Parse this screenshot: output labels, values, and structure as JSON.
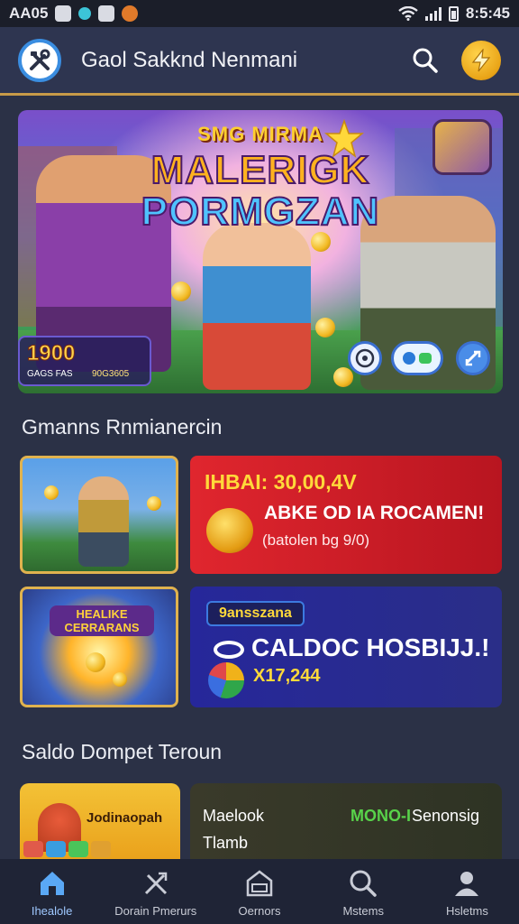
{
  "status_bar": {
    "left_text": "AA05",
    "time": "8:5:45"
  },
  "header": {
    "title": "Gaol Sakknd Nenmani"
  },
  "hero": {
    "subtitle": "SMG MIRMA",
    "title_line1": "MALERIGK",
    "title_line2": "PORMGZAN",
    "stat_value": "1900",
    "stat_label": "GAGS FAS",
    "stat_sub": "90G3605"
  },
  "sections": {
    "promo_title": "Gmanns Rnmianercin",
    "wallet_title": "Saldo Dompet Teroun"
  },
  "promos": {
    "thumb2_text": "HEALIKE CERRARANS",
    "red": {
      "title": "IHBAI: 30,00,4V",
      "main": "ABKE OD IA ROCAMEN!",
      "sub": "(batolen bg 9/0)"
    },
    "blue": {
      "badge": "9ansszana",
      "main": "CALDOC HOSBIJJ.!",
      "amount": "X17,244"
    }
  },
  "wallet": {
    "left_label": "Jodinaopah",
    "row1": "Maelook",
    "row2": "Tlamb",
    "status": "MONO-I",
    "status_text": "Senonsig"
  },
  "bottom_nav": {
    "items": [
      {
        "label": "Ihealole",
        "icon": "home-icon"
      },
      {
        "label": "Dorain Pmerurs",
        "icon": "tools-icon"
      },
      {
        "label": "Oernors",
        "icon": "store-icon"
      },
      {
        "label": "Mstems",
        "icon": "search-icon"
      },
      {
        "label": "Hsletms",
        "icon": "profile-icon"
      }
    ]
  },
  "colors": {
    "background": "#2b3146",
    "accent_gold": "#c79a48",
    "promo_red": "#e0262e",
    "promo_blue": "#26279a",
    "nav_active": "#9fc8ff"
  }
}
